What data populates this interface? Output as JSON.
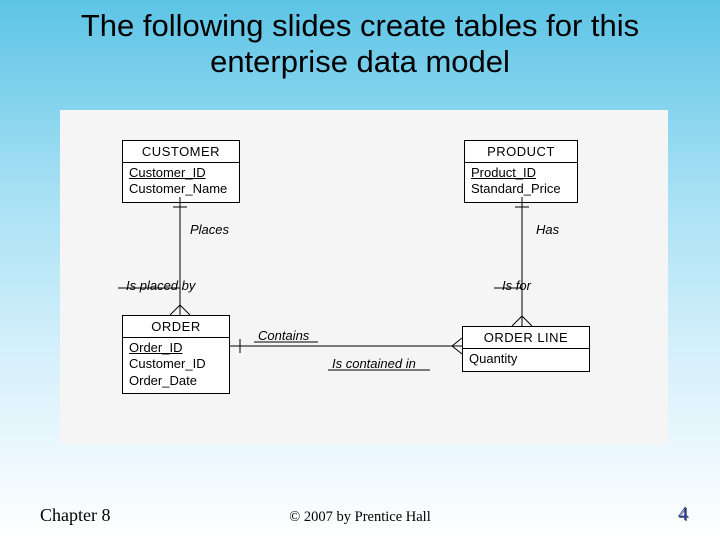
{
  "title": "The following slides create tables for this enterprise data model",
  "entities": {
    "customer": {
      "name": "CUSTOMER",
      "pk": "Customer_ID",
      "attrs": [
        "Customer_Name"
      ]
    },
    "product": {
      "name": "PRODUCT",
      "pk": "Product_ID",
      "attrs": [
        "Standard_Price"
      ]
    },
    "order": {
      "name": "ORDER",
      "pk": "Order_ID",
      "attrs": [
        "Customer_ID",
        "Order_Date"
      ]
    },
    "orderline": {
      "name": "ORDER LINE",
      "pk": "",
      "attrs": [
        "Quantity"
      ]
    }
  },
  "relationships": {
    "places": "Places",
    "is_placed_by": "Is placed by",
    "has": "Has",
    "is_for": "Is for",
    "contains": "Contains",
    "is_contained_in": "Is contained in"
  },
  "footer": {
    "chapter": "Chapter 8",
    "copyright": "© 2007 by Prentice Hall",
    "page": "4"
  }
}
